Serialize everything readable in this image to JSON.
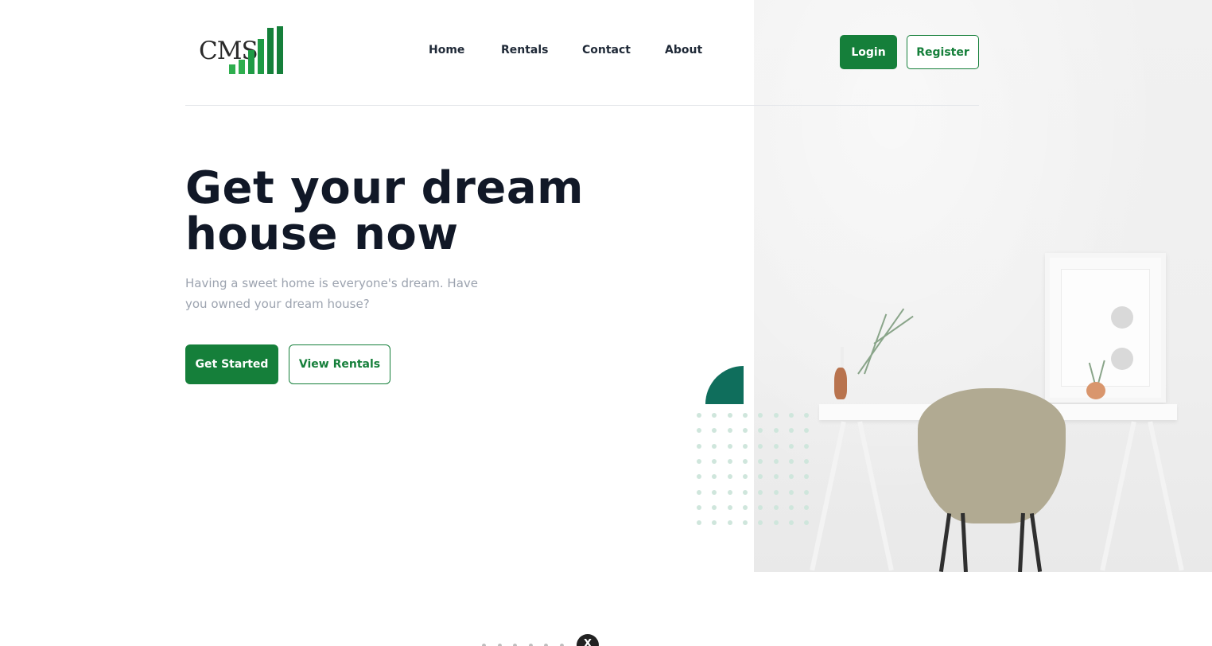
{
  "brand": {
    "logo_text": "CMS"
  },
  "nav": {
    "items": [
      {
        "label": "Home"
      },
      {
        "label": "Rentals"
      },
      {
        "label": "Contact"
      },
      {
        "label": "About"
      }
    ]
  },
  "auth": {
    "login_label": "Login",
    "register_label": "Register"
  },
  "hero": {
    "title": "Get your dream house now",
    "subtitle": "Having a sweet home is everyone's dream. Have you owned your dream house?",
    "primary_cta": "Get Started",
    "secondary_cta": "View Rentals"
  },
  "widget": {
    "close_label": "X"
  },
  "colors": {
    "primary": "#157f3a",
    "accent_teal": "#0f6e5c",
    "heading": "#111827",
    "muted_text": "#9ca3af",
    "dot_pattern": "#cfe6dc"
  }
}
